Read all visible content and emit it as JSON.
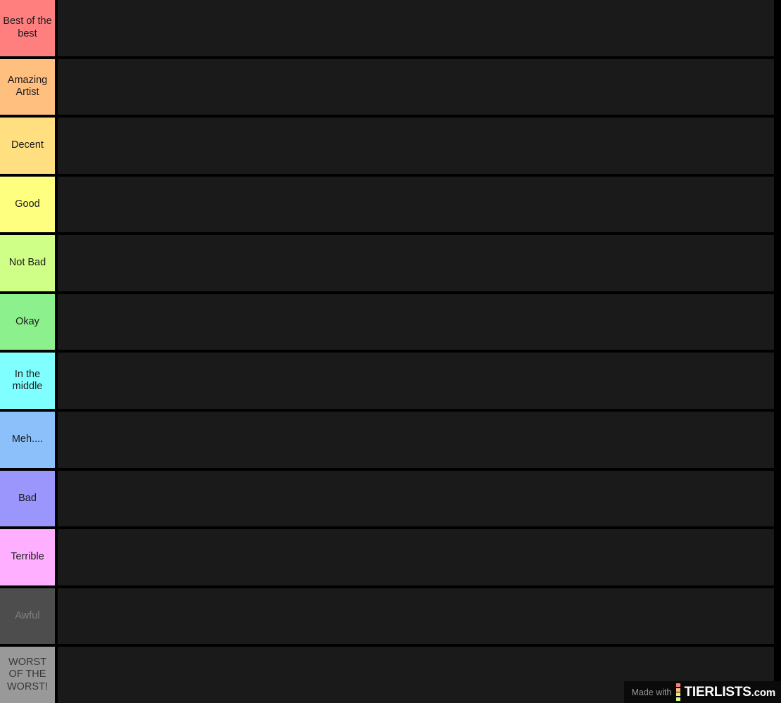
{
  "tierlist": {
    "background_color": "#000000",
    "item_area_color": "#1a1a1a",
    "rows": [
      {
        "label": "Best of the best",
        "color": "#ff7f7f",
        "text_color": "#1a1a1a",
        "items": []
      },
      {
        "label": "Amazing Artist",
        "color": "#ffbf7f",
        "text_color": "#1a1a1a",
        "items": []
      },
      {
        "label": "Decent",
        "color": "#ffdf80",
        "text_color": "#1a1a1a",
        "items": []
      },
      {
        "label": "Good",
        "color": "#ffff7f",
        "text_color": "#1a1a1a",
        "items": []
      },
      {
        "label": "Not Bad",
        "color": "#cfff86",
        "text_color": "#1a1a1a",
        "items": []
      },
      {
        "label": "Okay",
        "color": "#8cf08c",
        "text_color": "#1a1a1a",
        "items": []
      },
      {
        "label": "In the middle",
        "color": "#7fffff",
        "text_color": "#1a1a1a",
        "items": []
      },
      {
        "label": "Meh....",
        "color": "#8cc0fa",
        "text_color": "#1a1a1a",
        "items": []
      },
      {
        "label": "Bad",
        "color": "#9b96fc",
        "text_color": "#1a1a1a",
        "items": []
      },
      {
        "label": "Terrible",
        "color": "#ffafff",
        "text_color": "#1a1a1a",
        "items": []
      },
      {
        "label": "Awful",
        "color": "#4d4d4d",
        "text_color": "#808080",
        "items": []
      },
      {
        "label": "WORST OF THE WORST!",
        "color": "#999999",
        "text_color": "#383838",
        "items": []
      }
    ]
  },
  "watermark": {
    "made_with_label": "Made with",
    "brand_name": "TIERLISTS",
    "brand_tld": ".com",
    "logo_dot_colors": [
      "#ff7f7f",
      "#ffbf7f",
      "#ffdf80",
      "#cfff86"
    ]
  }
}
